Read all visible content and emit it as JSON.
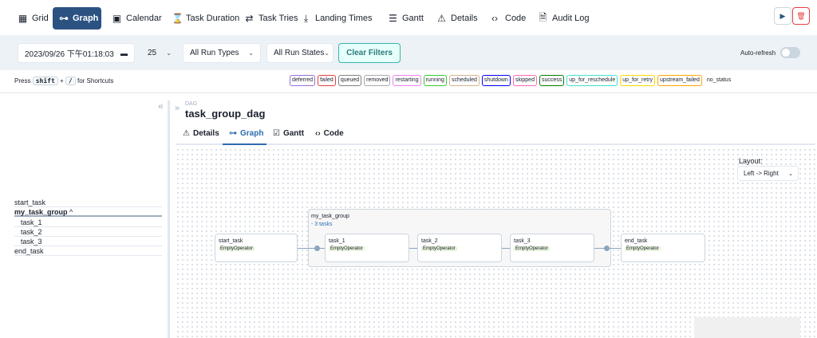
{
  "nav": {
    "grid": "Grid",
    "graph": "Graph",
    "calendar": "Calendar",
    "task_duration": "Task Duration",
    "task_tries": "Task Tries",
    "landing_times": "Landing Times",
    "gantt": "Gantt",
    "details": "Details",
    "code": "Code",
    "audit_log": "Audit Log"
  },
  "filters": {
    "datetime": "2023/09/26 下午01:18:03",
    "num_runs": "25",
    "run_types": "All Run Types",
    "run_states": "All Run States",
    "clear": "Clear Filters",
    "auto_refresh": "Auto-refresh",
    "auto_refresh_on": false
  },
  "shortcuts": {
    "prefix": "Press",
    "key1": "shift",
    "plus": "+",
    "key2": "/",
    "suffix": "for Shortcuts"
  },
  "legend": [
    {
      "label": "deferred",
      "color": "#9370db"
    },
    {
      "label": "failed",
      "color": "#e53e3e"
    },
    {
      "label": "queued",
      "color": "#808080"
    },
    {
      "label": "removed",
      "color": "#a9a9a9"
    },
    {
      "label": "restarting",
      "color": "#ee82ee"
    },
    {
      "label": "running",
      "color": "#32cd32"
    },
    {
      "label": "scheduled",
      "color": "#d2b48c"
    },
    {
      "label": "shutdown",
      "color": "#0000ff"
    },
    {
      "label": "skipped",
      "color": "#ff69b4"
    },
    {
      "label": "success",
      "color": "#008000"
    },
    {
      "label": "up_for_reschedule",
      "color": "#40e0d0"
    },
    {
      "label": "up_for_retry",
      "color": "#ffd700"
    },
    {
      "label": "upstream_failed",
      "color": "#ffa500"
    },
    {
      "label": "no_status",
      "color": ""
    }
  ],
  "tree": {
    "start_task": "start_task",
    "group": "my_task_group",
    "task_1": "task_1",
    "task_2": "task_2",
    "task_3": "task_3",
    "end_task": "end_task"
  },
  "dag": {
    "label": "DAG",
    "id": "task_group_dag"
  },
  "tabs": {
    "details": "Details",
    "graph": "Graph",
    "gantt": "Gantt",
    "code": "Code"
  },
  "layout": {
    "label": "Layout:",
    "value": "Left -> Right"
  },
  "graph": {
    "group_name": "my_task_group",
    "group_count": "- 3 tasks",
    "nodes": [
      {
        "id": "start_task",
        "operator": "EmptyOperator"
      },
      {
        "id": "task_1",
        "operator": "EmptyOperator"
      },
      {
        "id": "task_2",
        "operator": "EmptyOperator"
      },
      {
        "id": "task_3",
        "operator": "EmptyOperator"
      },
      {
        "id": "end_task",
        "operator": "EmptyOperator"
      }
    ]
  },
  "colors": {
    "accent": "#2c5282",
    "tab_active": "#2b6cb0"
  }
}
